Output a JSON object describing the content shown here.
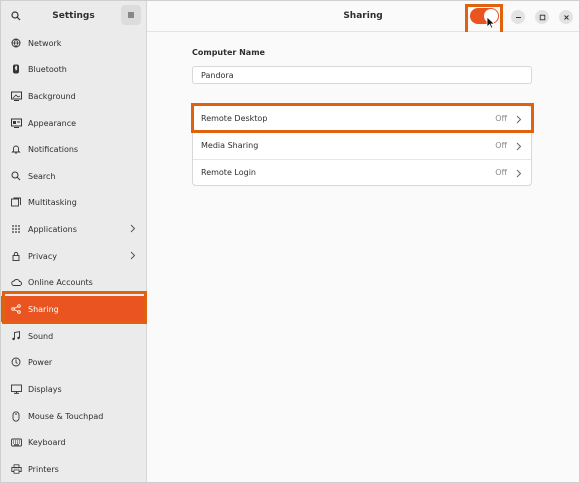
{
  "sidebar": {
    "title": "Settings",
    "items": [
      {
        "label": "Network",
        "icon": "network-icon",
        "chevron": false
      },
      {
        "label": "Bluetooth",
        "icon": "bluetooth-icon",
        "chevron": false
      },
      {
        "label": "Background",
        "icon": "background-icon",
        "chevron": false
      },
      {
        "label": "Appearance",
        "icon": "appearance-icon",
        "chevron": false
      },
      {
        "label": "Notifications",
        "icon": "bell-icon",
        "chevron": false
      },
      {
        "label": "Search",
        "icon": "search-icon",
        "chevron": false
      },
      {
        "label": "Multitasking",
        "icon": "multitasking-icon",
        "chevron": false
      },
      {
        "label": "Applications",
        "icon": "apps-grid-icon",
        "chevron": true
      },
      {
        "label": "Privacy",
        "icon": "lock-icon",
        "chevron": true
      },
      {
        "label": "Online Accounts",
        "icon": "cloud-icon",
        "chevron": false
      },
      {
        "label": "Sharing",
        "icon": "share-icon",
        "chevron": false,
        "active": true
      },
      {
        "label": "Sound",
        "icon": "music-note-icon",
        "chevron": false
      },
      {
        "label": "Power",
        "icon": "power-icon",
        "chevron": false
      },
      {
        "label": "Displays",
        "icon": "display-icon",
        "chevron": false
      },
      {
        "label": "Mouse & Touchpad",
        "icon": "mouse-icon",
        "chevron": false
      },
      {
        "label": "Keyboard",
        "icon": "keyboard-icon",
        "chevron": false
      },
      {
        "label": "Printers",
        "icon": "printer-icon",
        "chevron": false
      }
    ]
  },
  "header": {
    "title": "Sharing",
    "sharing_toggle_on": true
  },
  "content": {
    "computer_name_label": "Computer Name",
    "computer_name_value": "Pandora",
    "rows": [
      {
        "label": "Remote Desktop",
        "status": "Off"
      },
      {
        "label": "Media Sharing",
        "status": "Off"
      },
      {
        "label": "Remote Login",
        "status": "Off"
      }
    ]
  },
  "colors": {
    "accent": "#e95420",
    "highlight": "#e0620f"
  }
}
